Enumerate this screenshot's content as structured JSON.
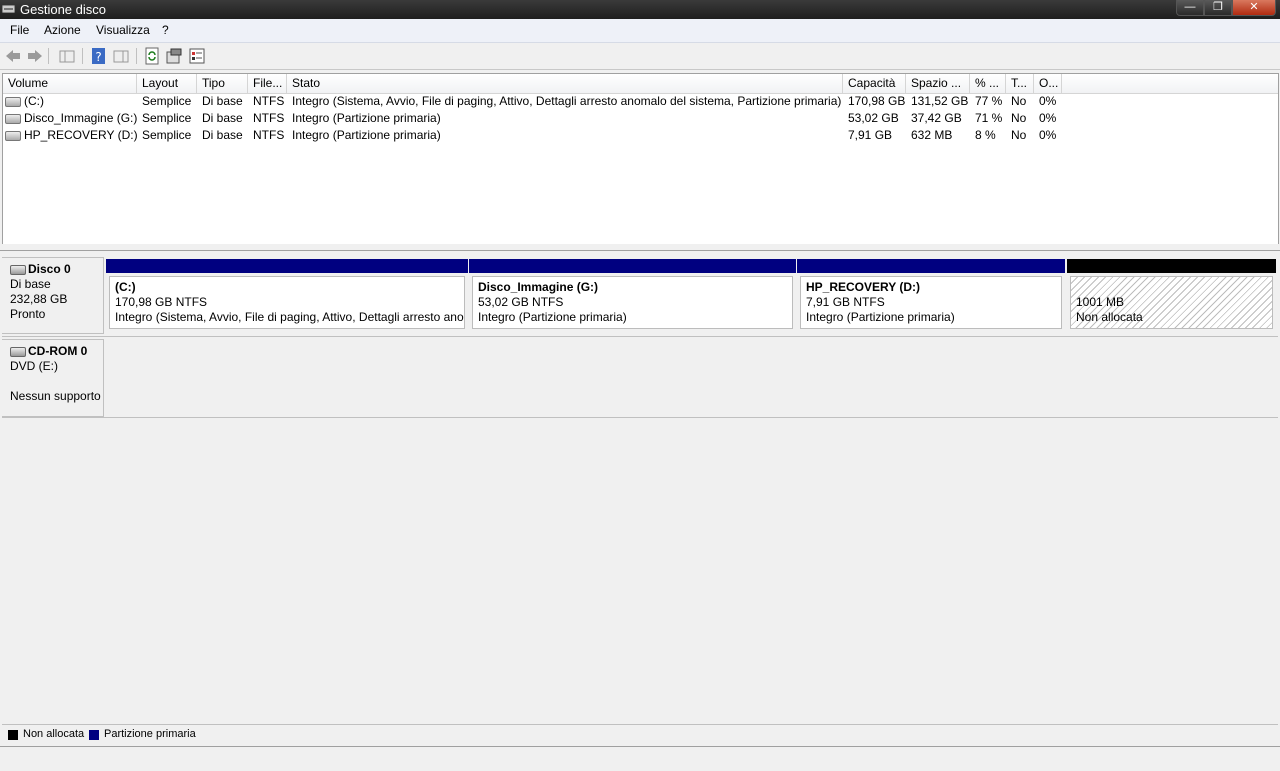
{
  "window": {
    "title": "Gestione disco"
  },
  "menu": {
    "file": "File",
    "azione": "Azione",
    "visualizza": "Visualizza",
    "help": "?"
  },
  "volumes": {
    "headers": [
      "Volume",
      "Layout",
      "Tipo",
      "File...",
      "Stato",
      "Capacità",
      "Spazio ...",
      "% ...",
      "T...",
      "O..."
    ],
    "rows": [
      [
        "(C:)",
        "Semplice",
        "Di base",
        "NTFS",
        "Integro (Sistema, Avvio, File di paging, Attivo, Dettagli arresto anomalo del sistema, Partizione primaria)",
        "170,98 GB",
        "131,52 GB",
        "77 %",
        "No",
        "0%"
      ],
      [
        "Disco_Immagine (G:)",
        "Semplice",
        "Di base",
        "NTFS",
        "Integro (Partizione primaria)",
        "53,02 GB",
        "37,42 GB",
        "71 %",
        "No",
        "0%"
      ],
      [
        "HP_RECOVERY (D:)",
        "Semplice",
        "Di base",
        "NTFS",
        "Integro (Partizione primaria)",
        "7,91 GB",
        "632 MB",
        "8 %",
        "No",
        "0%"
      ]
    ]
  },
  "disk0": {
    "name": "Disco 0",
    "type": "Di base",
    "size": "232,88 GB",
    "status": "Pronto",
    "partitions": [
      {
        "name": "(C:)",
        "size": "170,98 GB NTFS",
        "status": "Integro (Sistema, Avvio, File di paging, Attivo, Dettagli arresto ano"
      },
      {
        "name": "Disco_Immagine  (G:)",
        "size": "53,02 GB NTFS",
        "status": "Integro (Partizione primaria)"
      },
      {
        "name": "HP_RECOVERY  (D:)",
        "size": "7,91 GB NTFS",
        "status": "Integro (Partizione primaria)"
      },
      {
        "name": "",
        "size": "1001 MB",
        "status": "Non allocata"
      }
    ]
  },
  "cdrom0": {
    "name": "CD-ROM 0",
    "type": "DVD (E:)",
    "status": "Nessun supporto"
  },
  "legend": {
    "unallocated": "Non allocata",
    "primary": "Partizione primaria"
  },
  "colors": {
    "primary": "#000080",
    "unallocated": "#000000"
  }
}
